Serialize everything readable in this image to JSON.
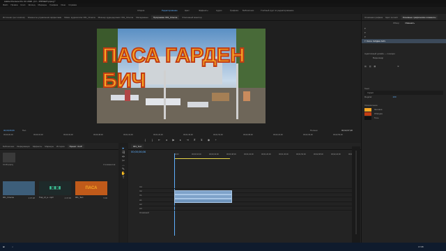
{
  "window": {
    "title": "Adobe Premiere Pro CC 2018 - [C:\\...\\ПРОЕКТ.prproj] *"
  },
  "menu": [
    "Файл",
    "Правка",
    "Клип",
    "Эпизод",
    "Маркеры",
    "Графика",
    "Окно",
    "Справка"
  ],
  "workspaces": [
    {
      "label": "Сборка",
      "active": false
    },
    {
      "label": "Редактирование",
      "active": true
    },
    {
      "label": "Цвет",
      "active": false
    },
    {
      "label": "Эффекты",
      "active": false
    },
    {
      "label": "Аудио",
      "active": false
    },
    {
      "label": "Графика",
      "active": false
    },
    {
      "label": "Библиотеки",
      "active": false
    },
    {
      "label": "Учебный курс по редактированию",
      "active": false
    }
  ],
  "source_tabs": [
    "Источник: (нет клипов)",
    "Элементы управления эффектами",
    "Микш. аудиоклипа: 001_Cinema",
    "Микшер аудиодорожек: 001_Cinema",
    "Метаданные",
    "Программа: 001_Cinema",
    "Эталонный монитор"
  ],
  "title_overlay": {
    "line1": "ПАСА ГАРДЕН",
    "line2": "БИЧ"
  },
  "program": {
    "timecode_left": "00;00;06;06",
    "fit": "Пол.",
    "quality": "Полная",
    "timecode_right": "00;02;07;28"
  },
  "ruler": [
    "00;00;00;00",
    "00;00;16;00",
    "00;00;32;00",
    "00;00;48;00",
    "00;01;04;00",
    "00;01;20;00",
    "00;01;36;00",
    "00;01;52;00",
    "00;02;08;00",
    "00;02;24;00",
    "00;02;40;00",
    "00;02;56;00"
  ],
  "project": {
    "tabs": [
      "Библиотеки",
      "Информация",
      "Эффекты",
      "Маркеры",
      "История",
      "Проект: CLIP"
    ],
    "file": "CLIP.prproj",
    "count": "3 элементов",
    "items": [
      {
        "name": "001_Cinema",
        "dur": "2:07:28",
        "kind": "video"
      },
      {
        "name": "Trap_dr_a...mp3",
        "dur": "2:47:03",
        "kind": "audio"
      },
      {
        "name": "001_Text",
        "dur": "5:00",
        "kind": "title"
      }
    ]
  },
  "timeline": {
    "tab": "001_Text",
    "timecode": "00;00;06;06",
    "ruler": [
      "00;00",
      "00;00;16;00",
      "00;00;32;00",
      "00;00;48;00",
      "00;01;04;00",
      "00;01;20;00",
      "00;01;36;00",
      "00;01;52;00",
      "00;02;08;00",
      "00;02;24;00",
      "00;02;40;00"
    ],
    "video_tracks": [
      "V3",
      "V2",
      "V1"
    ],
    "audio_tracks": [
      "A1",
      "A2",
      "A3"
    ],
    "master": "Основной"
  },
  "graphics": {
    "tabs": [
      "Основная графика",
      "Цвет Lumetri",
      "Основные графические элементы"
    ],
    "subtabs": [
      "Обзор",
      "Изменить"
    ],
    "layers": [
      "ПАСА ГАРДЕН БИЧ"
    ],
    "align_label": "Адаптивный дизайн — позиция",
    "align_value": "Видеокадр",
    "text_label": "Текст",
    "font": "Impact",
    "font_style": "Regular",
    "font_size": "100",
    "appearance_label": "Оформление",
    "fill_label": "Заливка",
    "stroke_label": "Обводка",
    "shadow_label": "Тень",
    "fill_color": "#f7a826",
    "stroke_color": "#c23c13",
    "accent": "#5fb0ff"
  },
  "taskbar": {
    "time": "17:08",
    "date": "01.11.2018"
  }
}
